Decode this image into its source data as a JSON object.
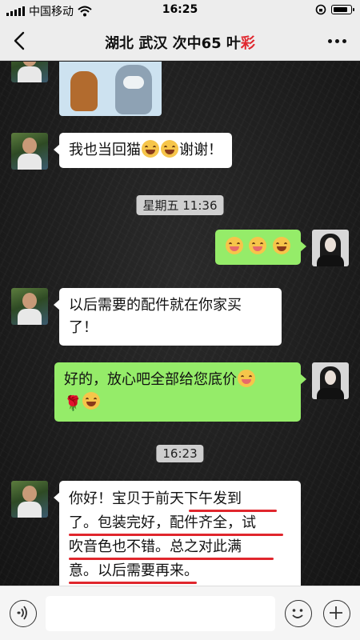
{
  "statusbar": {
    "carrier": "中国移动",
    "time": "16:25"
  },
  "header": {
    "title": "湖北 武汉 次中65 叶",
    "title_redacted": "彩"
  },
  "messages": [
    {
      "sender": "other",
      "type": "image",
      "image": "cartoon-cat-and-mouse"
    },
    {
      "sender": "other",
      "text": "我也当回猫",
      "emojis_after": [
        "grin",
        "grin"
      ],
      "tail": "谢谢！"
    },
    {
      "type": "timestamp",
      "text": "星期五 11:36"
    },
    {
      "sender": "self",
      "emojis": [
        "tongue",
        "tongue",
        "laugh-cry"
      ]
    },
    {
      "sender": "other",
      "line1": "以后需要的配件就在你家买",
      "line2": "了！"
    },
    {
      "sender": "self",
      "line1": "好的，放心吧全部给您底价",
      "line2_icons": [
        "rose",
        "smile"
      ]
    },
    {
      "type": "timestamp",
      "text": "16:23"
    },
    {
      "sender": "other",
      "lines": [
        "你好！宝贝于前天下午发到",
        "了。包装完好，配件齐全，试",
        "吹音色也不错。总之对此满",
        "意。以后需要再来。"
      ]
    }
  ],
  "toolbar": {
    "voice_icon": "voice-icon",
    "emoji_icon": "emoji-icon",
    "plus_icon": "plus-icon"
  },
  "colors": {
    "self_bubble": "#95ec69",
    "other_bubble": "#ffffff",
    "underline": "#e0262d"
  }
}
